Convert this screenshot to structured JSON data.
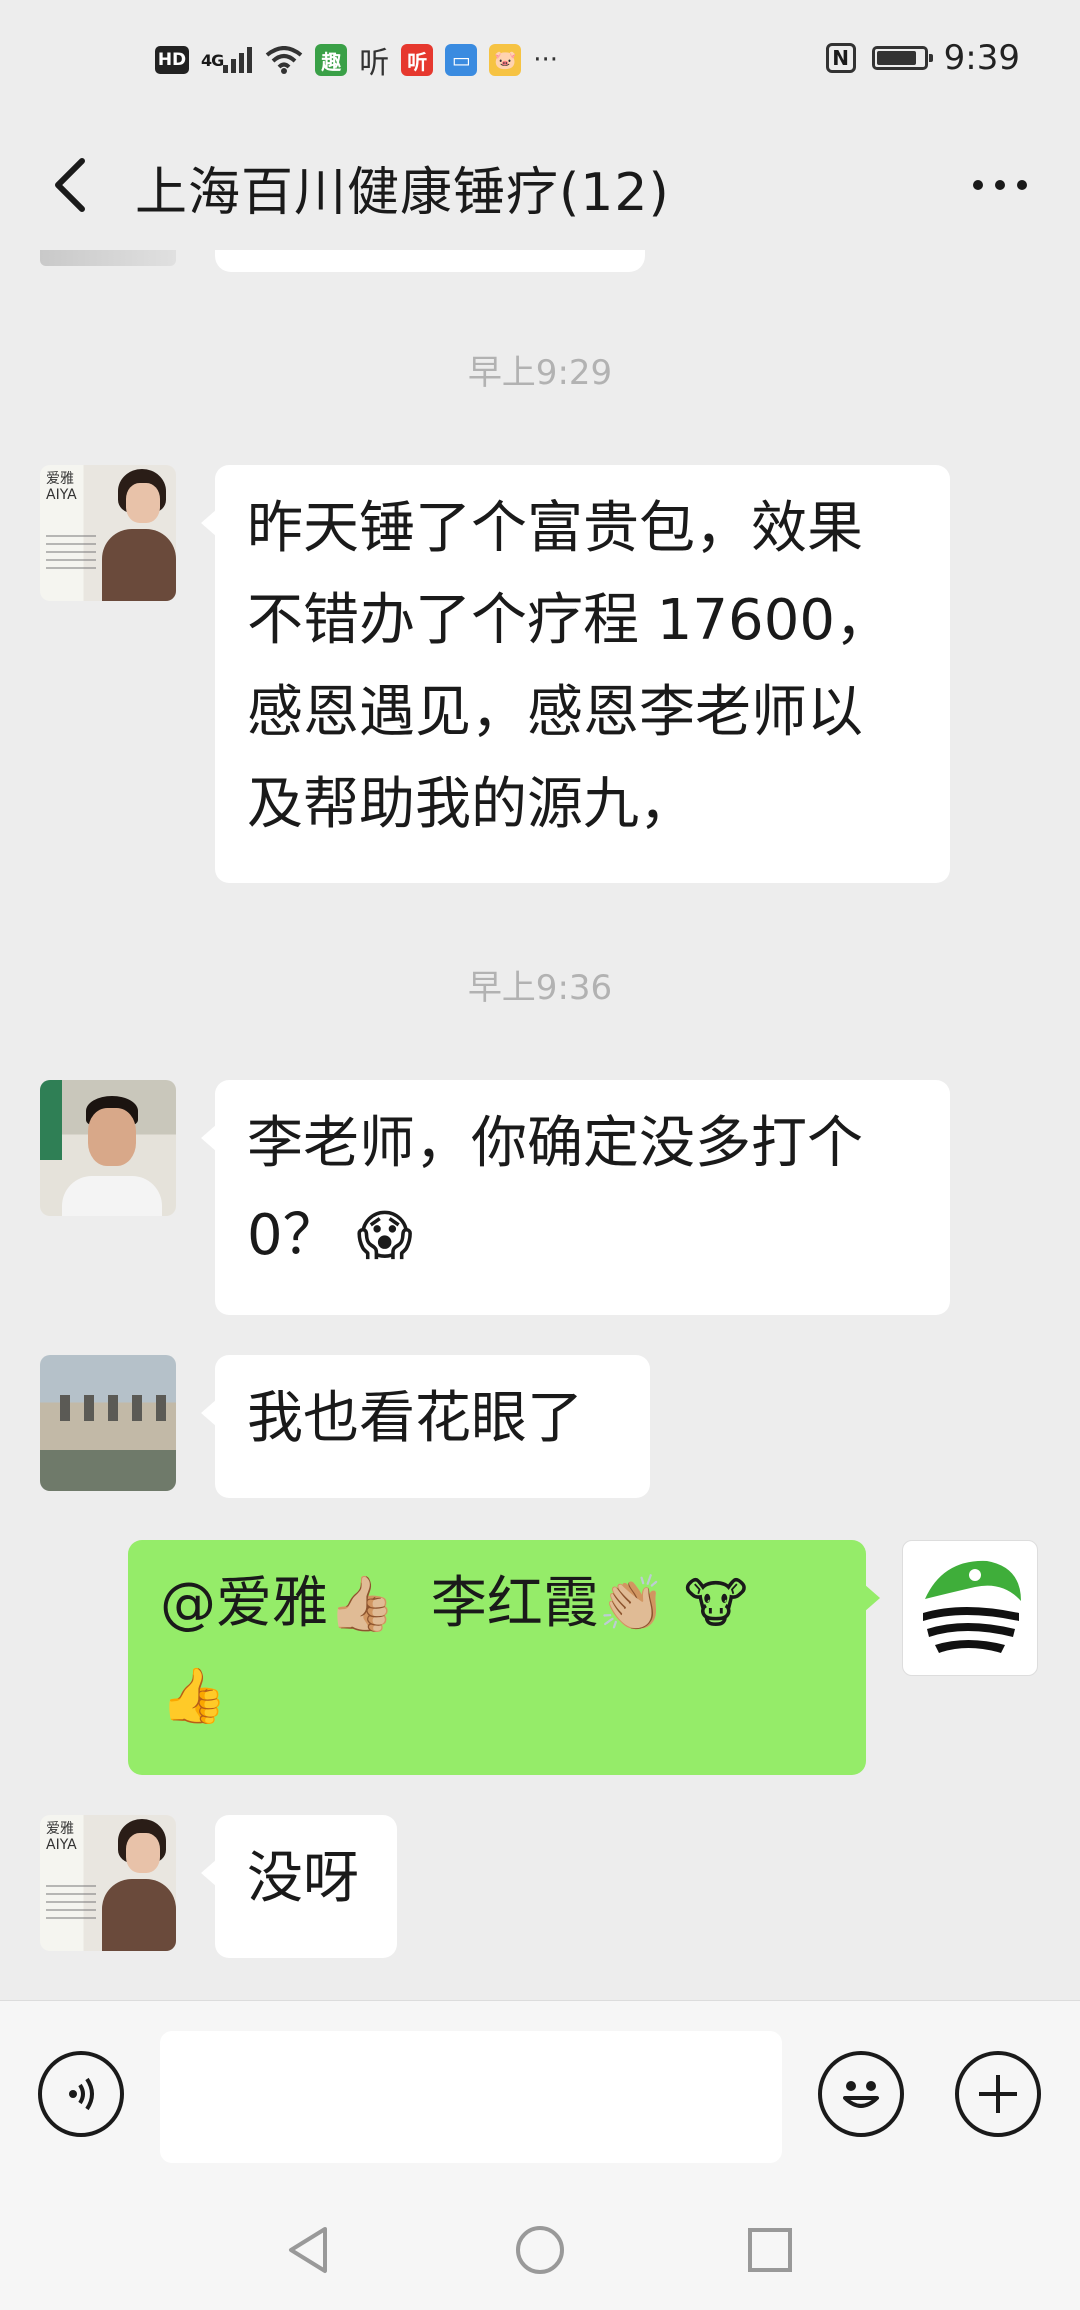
{
  "status_bar": {
    "hd": "HD",
    "signal": "4G",
    "app_icons": [
      {
        "name": "qutoutiao-icon",
        "glyph": "趣",
        "color": "#3aa047"
      },
      {
        "name": "ting-outline-icon",
        "glyph": "听",
        "color": "#333333"
      },
      {
        "name": "ting-red-icon",
        "glyph": "听",
        "color": "#e6382e"
      },
      {
        "name": "card-app-icon",
        "glyph": "▭",
        "color": "#3a8be0"
      },
      {
        "name": "pig-app-icon",
        "glyph": "🐷",
        "color": "#f6c343"
      }
    ],
    "overflow": "···",
    "nfc": "N",
    "time": "9:39"
  },
  "header": {
    "title": "上海百川健康锤疗(12)"
  },
  "messages": [
    {
      "type": "timestamp",
      "text": "早上9:29"
    },
    {
      "type": "incoming",
      "avatar": "woman",
      "lines": [
        "昨天锤了个富贵包，效果",
        "不错办了个疗程 17600，",
        "感恩遇见，感恩李老师以",
        "及帮助我的源九，"
      ]
    },
    {
      "type": "timestamp",
      "text": "早上9:36"
    },
    {
      "type": "incoming",
      "avatar": "man",
      "lines": [
        "李老师，你确定没多打个",
        "0？"
      ],
      "emoji": "😱"
    },
    {
      "type": "incoming",
      "avatar": "building",
      "lines": [
        "我也看花眼了"
      ]
    },
    {
      "type": "outgoing",
      "avatar": "logo",
      "mention": "@爱雅",
      "thumb": "👍🏼",
      "name": "李红霞",
      "clap": "👏🏼",
      "cow": "🐮",
      "thumb2": "👍"
    },
    {
      "type": "incoming",
      "avatar": "woman",
      "lines": [
        "没呀"
      ]
    }
  ],
  "avatar_woman": {
    "logo_text": "爱雅 AIYA"
  },
  "input": {
    "placeholder": ""
  }
}
